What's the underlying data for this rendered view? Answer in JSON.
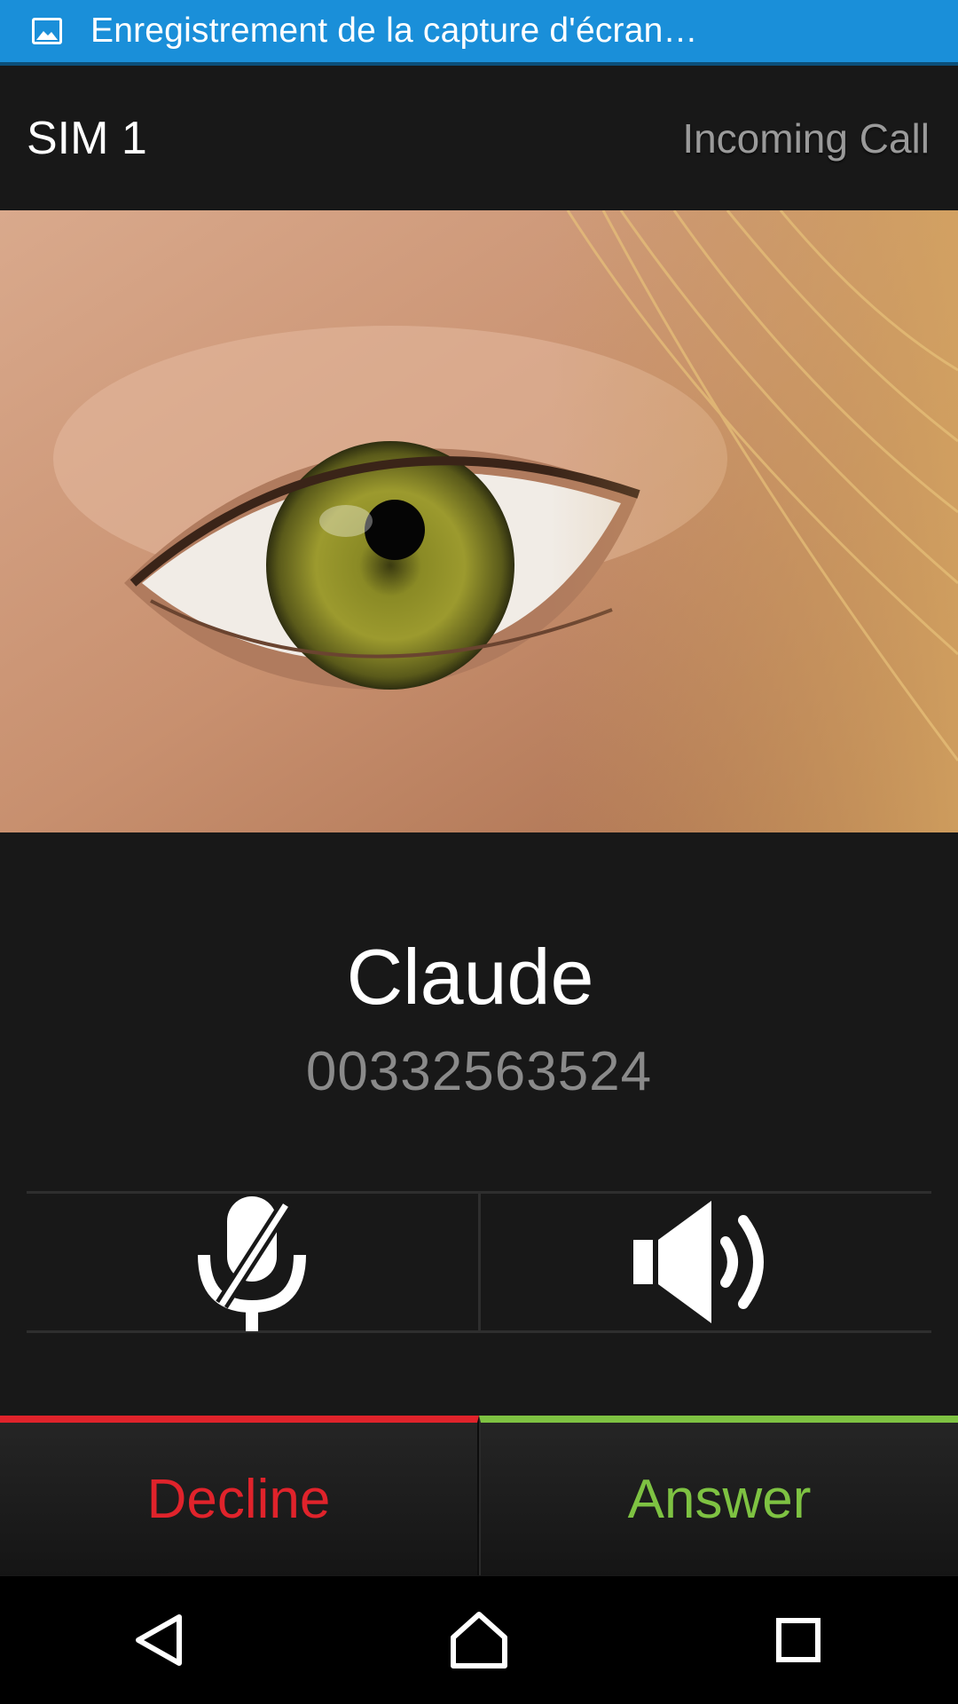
{
  "status_bar": {
    "icon": "image-icon",
    "notification": "Enregistrement de la capture d'écran…",
    "color": "#1a8fd9"
  },
  "header": {
    "sim": "SIM 1",
    "call_state": "Incoming Call"
  },
  "caller": {
    "name": "Claude",
    "number": "00332563524"
  },
  "controls": {
    "mute_icon": "mic-off-icon",
    "speaker_icon": "speaker-icon"
  },
  "actions": {
    "decline_label": "Decline",
    "answer_label": "Answer",
    "decline_color": "#e0232b",
    "answer_color": "#7ec242"
  },
  "navigation": {
    "back": "back-icon",
    "home": "home-icon",
    "recents": "recents-icon"
  }
}
